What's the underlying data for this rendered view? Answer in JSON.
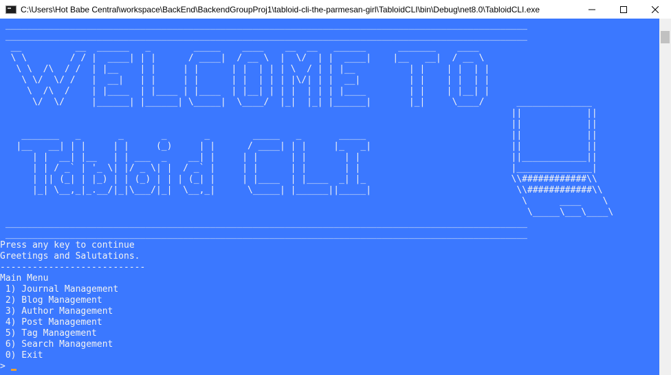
{
  "window": {
    "title": "C:\\Users\\Hot Babe Central\\workspace\\BackEnd\\BackendGroupProj1\\tabloid-cli-the-parmesan-girl\\TabloidCLI\\bin\\Debug\\net8.0\\TabloidCLI.exe",
    "icons": {
      "app": "console-app-icon",
      "minimize": "minimize-icon",
      "maximize": "maximize-icon",
      "close": "close-icon"
    }
  },
  "console": {
    "banner_art": " _________________________________________________________________________________________________\n _________________________________________________________________________________________________\n  __          __  ______   _        _____    ____    __  __   ______      _______    ____  \n  \\ \\        / / |  ____| | |      / ____|  / __ \\  |  \\/  | |  ____|    |__   __|  / __ \\ \n   \\ \\  /\\  / /  | |__    | |     | |      | |  | | | \\  / | | |__          | |    | |  | |\n    \\ \\/  \\/ /   |  __|   | |     | |      | |  | | | |\\/| | |  __|         | |    | |  | |\n     \\  /\\  /    | |____  | |____ | |____  | |__| | | |  | | | |____        | |    | |__| |\n      \\/  \\/     |______| |______| \\_____|  \\____/  |_|  |_| |______|       |_|     \\____/      ______________\n                                                                                               ||            ||\n                                                                                               ||            ||\n    _______   _       _       _       _        _____   _       _____                           ||            ||\n   |__   __| | |     | |     (_)     | |      / ____| | |     |_   _|                          ||            ||\n      | |  __| |__   | | ___  _    __| |     | |      | |       | |                            ||____________||\n      | | / _` | '_ \\| |/ _ \\| |  / _` |     | |      | |       | |                            |______________|\n      | || (_| | |_) | | (_) | | | (_| |     | |____  | |____  _| |_                           \\\\############\\\\\n      |_| \\__,_|_.__/|_|\\___/|_|  \\__,_|      \\_____| |______||_____|                           \\\\############\\\\\n                                                                                                 \\      ____    \\\n                                                                                                  \\_____\\___\\____\\\n _________________________________________________________________________________________________\n _________________________________________________________________________________________________",
    "lines": {
      "press_key": "Press any key to continue",
      "greeting": "Greetings and Salutations.",
      "divider": "---------------------------",
      "menu_title": "Main Menu",
      "item_1": " 1) Journal Management",
      "item_2": " 2) Blog Management",
      "item_3": " 3) Author Management",
      "item_4": " 4) Post Management",
      "item_5": " 5) Tag Management",
      "item_6": " 6) Search Management",
      "item_0": " 0) Exit",
      "prompt": ">"
    },
    "colors": {
      "background": "#3b78ff",
      "text": "#f2f2f2",
      "cursor": "#f0a030"
    }
  }
}
